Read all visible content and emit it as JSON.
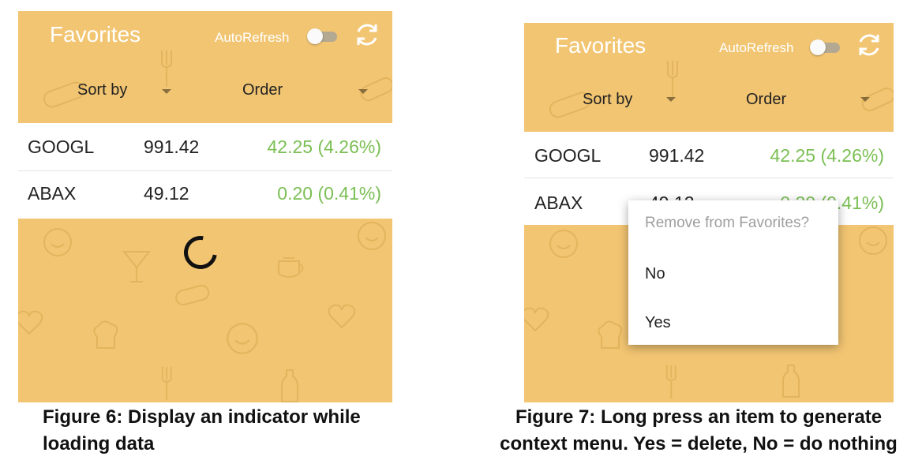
{
  "colors": {
    "app_background": "#f2c572",
    "positive_change": "#7bbf54",
    "title_text": "#ffffff"
  },
  "screens": [
    {
      "app_title": "Favorites",
      "auto_refresh_label": "AutoRefresh",
      "auto_refresh_on": false,
      "sort_by_label": "Sort by",
      "order_label": "Order",
      "stocks": [
        {
          "symbol": "GOOGL",
          "price": "991.42",
          "change": "42.25 (4.26%)"
        },
        {
          "symbol": "ABAX",
          "price": "49.12",
          "change": "0.20 (0.41%)"
        }
      ],
      "loading_indicator_visible": true,
      "caption_line1": "Figure 6: Display an indicator while",
      "caption_line2": "loading data"
    },
    {
      "app_title": "Favorites",
      "auto_refresh_label": "AutoRefresh",
      "auto_refresh_on": false,
      "sort_by_label": "Sort by",
      "order_label": "Order",
      "stocks": [
        {
          "symbol": "GOOGL",
          "price": "991.42",
          "change": "42.25 (4.26%)"
        },
        {
          "symbol": "ABAX",
          "price": "49.12",
          "change": "0.20 (0.41%)"
        }
      ],
      "context_menu": {
        "title": "Remove from Favorites?",
        "items": [
          "No",
          "Yes"
        ]
      },
      "caption_line1": "Figure 7: Long press an item to generate",
      "caption_line2": "context menu. Yes = delete, No = do nothing"
    }
  ]
}
